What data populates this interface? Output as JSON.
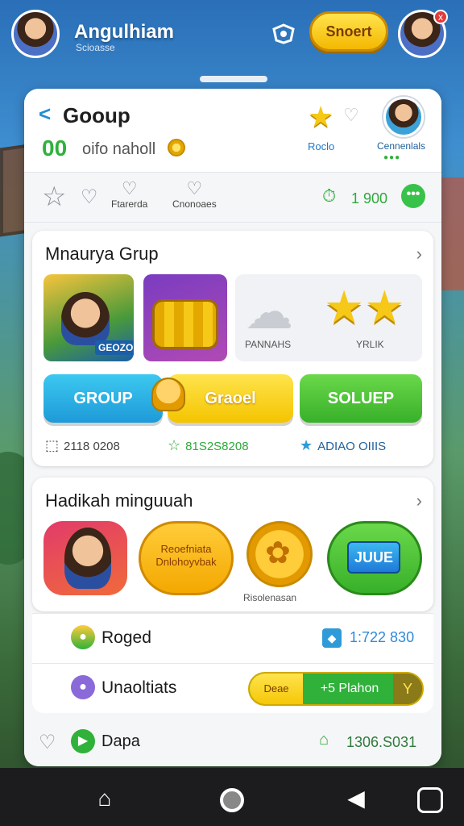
{
  "topbar": {
    "app_title": "Angulhiam",
    "app_subtitle": "Scioasse",
    "gold_button": "Snoert",
    "badge": "x"
  },
  "header": {
    "back": "<",
    "title": "Gooup",
    "score": "00",
    "score_sub": "oifo naholl",
    "rank_label": "Roclo",
    "avatar_label": "Cennenlals",
    "avatar_dots": "●●●"
  },
  "filters": {
    "item1_label": "Ftarerda",
    "item2_label": "Cnonoaes",
    "timer": "1 900",
    "more": "•••"
  },
  "card1": {
    "title": "Mnaurya Grup",
    "tile_a_tag": "GEOZO",
    "tile_c_label1": "PANNAHS",
    "tile_c_label2": "YRLIK",
    "btn_group": "GROUP",
    "btn_yellow": "Graoel",
    "btn_green": "SOLUEP",
    "stat1": "2118 0208",
    "stat2": "81S2S8208",
    "stat3": "ADIAO OIIIS"
  },
  "card2": {
    "title": "Hadikah minguuah",
    "rt_b_text": "Reoefniata Dnlohoyvbak",
    "rt_c_label": "Risolenasan",
    "rt_d_text": "JUUE"
  },
  "rows": [
    {
      "label": "Roged",
      "right": "1:722 830"
    },
    {
      "label": "Unaoltiats",
      "pill_left": "Deae",
      "pill_mid": "+5 Plahon",
      "pill_end": "Y"
    }
  ],
  "footer": {
    "label": "Dapa",
    "value": "1306.S031"
  },
  "colors": {
    "accent_green": "#2fb13a",
    "accent_blue": "#1f8fd8",
    "gold": "#f6c817"
  }
}
